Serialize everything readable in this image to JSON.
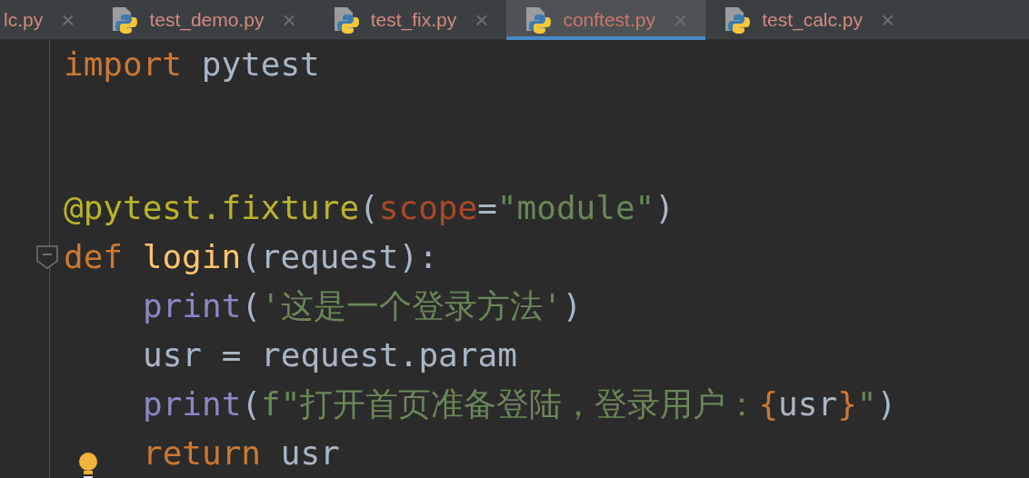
{
  "tabs": [
    {
      "label": "lc.py",
      "selected": false,
      "icon": false
    },
    {
      "label": "test_demo.py",
      "selected": false,
      "icon": true
    },
    {
      "label": "test_fix.py",
      "selected": false,
      "icon": true
    },
    {
      "label": "conftest.py",
      "selected": true,
      "icon": true
    },
    {
      "label": "test_calc.py",
      "selected": false,
      "icon": true
    }
  ],
  "close_glyph": "×",
  "editor": {
    "lines": [
      {
        "kind": "code",
        "tokens": [
          {
            "kind": "keyword",
            "text": "import"
          },
          {
            "kind": "plain",
            "text": " pytest"
          }
        ]
      },
      {
        "kind": "blank"
      },
      {
        "kind": "blank"
      },
      {
        "kind": "code",
        "tokens": [
          {
            "kind": "decorator",
            "text": "@pytest.fixture"
          },
          {
            "kind": "plain",
            "text": "("
          },
          {
            "kind": "param",
            "text": "scope"
          },
          {
            "kind": "plain",
            "text": "="
          },
          {
            "kind": "string",
            "text": "\"module\""
          },
          {
            "kind": "plain",
            "text": ")"
          }
        ]
      },
      {
        "kind": "code",
        "fold": true,
        "tokens": [
          {
            "kind": "keyword",
            "text": "def "
          },
          {
            "kind": "function",
            "text": "login"
          },
          {
            "kind": "plain",
            "text": "(request):"
          }
        ],
        "children": [
          {
            "kind": "code",
            "tokens": [
              {
                "kind": "builtin",
                "text": "print"
              },
              {
                "kind": "plain",
                "text": "("
              },
              {
                "kind": "string",
                "text": "'这是一个登录方法'"
              },
              {
                "kind": "plain",
                "text": ")"
              }
            ]
          },
          {
            "kind": "code",
            "tokens": [
              {
                "kind": "plain",
                "text": "usr = request.param"
              }
            ]
          },
          {
            "kind": "code",
            "tokens": [
              {
                "kind": "builtin",
                "text": "print"
              },
              {
                "kind": "plain",
                "text": "("
              },
              {
                "kind": "string",
                "text": "f\"打开首页准备登陆，登录用户："
              },
              {
                "kind": "keyword",
                "text": "{"
              },
              {
                "kind": "plain",
                "text": "usr"
              },
              {
                "kind": "keyword",
                "text": "}"
              },
              {
                "kind": "string",
                "text": "\""
              },
              {
                "kind": "plain",
                "text": ")"
              }
            ]
          },
          {
            "kind": "code",
            "bulb": true,
            "tokens": [
              {
                "kind": "keyword",
                "text": "return"
              },
              {
                "kind": "plain",
                "text": " usr"
              }
            ]
          }
        ]
      }
    ]
  }
}
